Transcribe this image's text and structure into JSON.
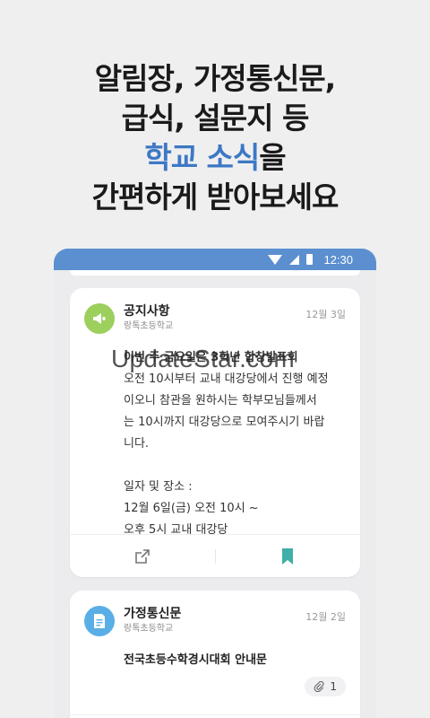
{
  "headline": {
    "line1": "알림장, 가정통신문,",
    "line2": "급식, 설문지 등",
    "line3_accent": "학교 소식",
    "line3_suffix": "을",
    "line4": "간편하게 받아보세요"
  },
  "status_bar": {
    "time": "12:30",
    "background": "#5b8fcf",
    "icons": [
      "wifi-icon",
      "signal-icon",
      "battery-icon"
    ]
  },
  "cards": [
    {
      "icon": "megaphone-icon",
      "icon_color": "#9ccf5c",
      "title": "공지사항",
      "school": "랑톡초등학교",
      "date": "12월 3일",
      "body": [
        "이번 주 금요일은 3학년 합창발표회",
        "오전 10시부터 교내 대강당에서 진행 예정",
        "이오니 참관을 원하시는 학부모님들께서",
        "는 10시까지 대강당으로 모여주시기 바랍",
        "니다.",
        "",
        "일자 및 장소 :",
        "12월 6일(금) 오전 10시 ~",
        "오후 5시 교내 대강당"
      ],
      "actions": [
        "share-icon",
        "bookmark-icon"
      ]
    },
    {
      "icon": "document-icon",
      "icon_color": "#5aaee6",
      "title": "가정통신문",
      "school": "랑톡초등학교",
      "date": "12월 2일",
      "headline": "전국초등수학경시대회 안내문",
      "attachment_count": "1"
    }
  ],
  "watermark": "UpdateStar.com",
  "accent_color": "#3d78c4"
}
